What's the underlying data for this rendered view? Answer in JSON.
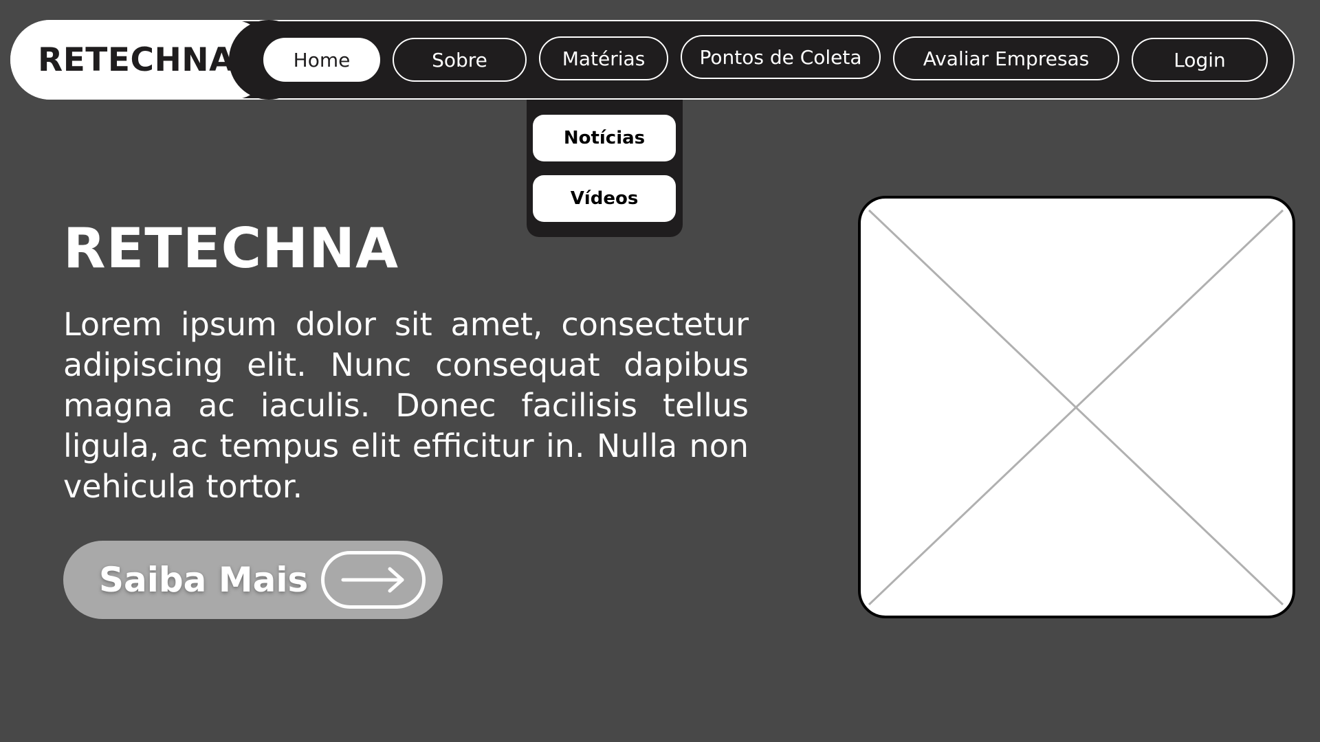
{
  "navbar": {
    "brand": "RETECHNA",
    "items": [
      {
        "id": "home",
        "label": "Home",
        "active": true
      },
      {
        "id": "sobre",
        "label": "Sobre",
        "active": false
      },
      {
        "id": "materias",
        "label": "Matérias",
        "active": false
      },
      {
        "id": "pontos",
        "label": "Pontos de Coleta",
        "active": false
      },
      {
        "id": "avaliar",
        "label": "Avaliar Empresas",
        "active": false
      },
      {
        "id": "login",
        "label": "Login",
        "active": false
      }
    ]
  },
  "dropdown": {
    "items": [
      {
        "label": "Notícias"
      },
      {
        "label": "Vídeos"
      }
    ]
  },
  "hero": {
    "title": "RETECHNA",
    "body": "Lorem ipsum dolor sit amet, consectetur adipiscing elit. Nunc consequat dapibus magna ac iaculis. Donec facilisis tellus ligula, ac tempus elit efficitur in. Nulla non vehicula tortor.",
    "cta_label": "Saiba Mais",
    "cta_icon": "arrow-right-icon"
  },
  "image": {
    "icon": "image-placeholder-icon"
  },
  "colors": {
    "background": "#484848",
    "nav_background": "#1f1d1e",
    "white": "#ffffff",
    "cta_background": "#a9a9a9",
    "placeholder_line": "#b0b0b0"
  }
}
